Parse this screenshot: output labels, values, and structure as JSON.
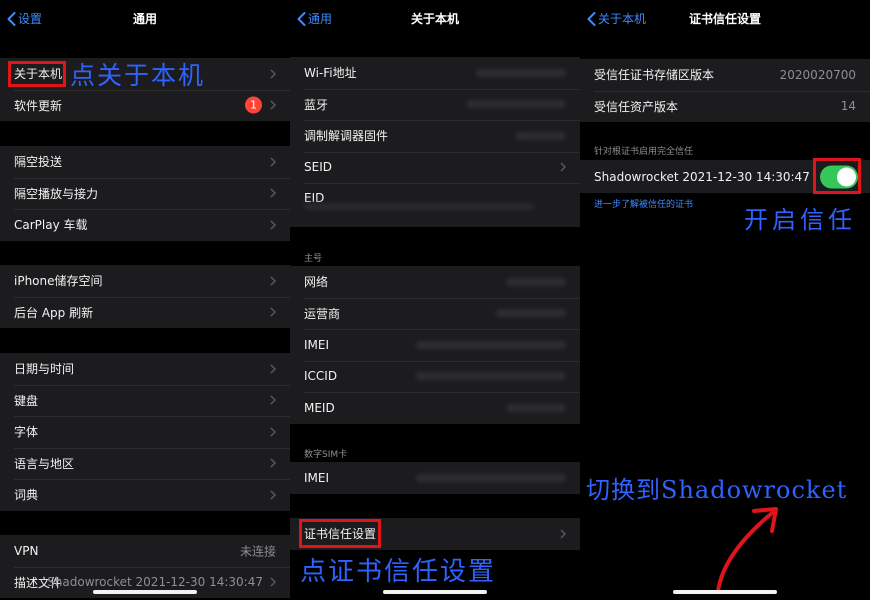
{
  "p1": {
    "back": "设置",
    "title": "通用",
    "g1": [
      "关于本机",
      "软件更新"
    ],
    "badge": "1",
    "g2": [
      "隔空投送",
      "隔空播放与接力",
      "CarPlay 车载"
    ],
    "g3": [
      "iPhone储存空间",
      "后台 App 刷新"
    ],
    "g4": [
      "日期与时间",
      "键盘",
      "字体",
      "语言与地区",
      "词典"
    ],
    "g5": [
      {
        "label": "VPN",
        "value": "未连接"
      },
      {
        "label": "描述文件",
        "value": "Shadowrocket 2021-12-30 14:30:47"
      }
    ],
    "annotation": "点关于本机"
  },
  "p2": {
    "back": "通用",
    "title": "关于本机",
    "g1": [
      "Wi-Fi地址",
      "蓝牙",
      "调制解调器固件",
      "SEID",
      "EID"
    ],
    "section_main": "主号",
    "g2": [
      "网络",
      "运营商",
      "IMEI",
      "ICCID",
      "MEID"
    ],
    "section_sim": "数字SIM卡",
    "g3": [
      "IMEI"
    ],
    "g4": [
      "证书信任设置"
    ],
    "annotation": "点证书信任设置"
  },
  "p3": {
    "back": "关于本机",
    "title": "证书信任设置",
    "g1": [
      {
        "label": "受信任证书存储区版本",
        "value": "2020020700"
      },
      {
        "label": "受信任资产版本",
        "value": "14"
      }
    ],
    "section": "针对根证书启用完全信任",
    "cert": "Shadowrocket 2021-12-30 14:30:47",
    "toggle_on": true,
    "link": "进一步了解被信任的证书",
    "annotation_trust": "开启信任",
    "annotation_switch": "切换到Shadowrocket"
  },
  "colors": {
    "accent": "#3d8bff",
    "annotation": "#2f62ff",
    "highlight": "#e0151a",
    "toggle": "#34c759",
    "badge": "#ff453a"
  }
}
